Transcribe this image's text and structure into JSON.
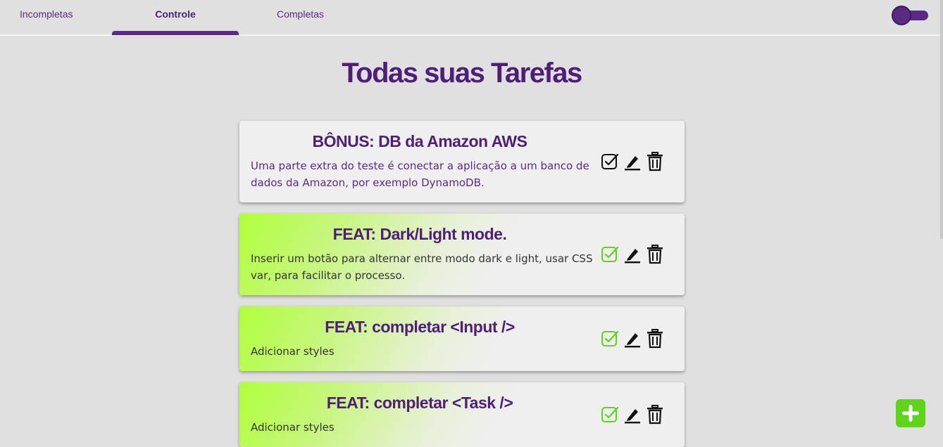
{
  "tabs": [
    {
      "label": "Incompletas"
    },
    {
      "label": "Controle",
      "active": true
    },
    {
      "label": "Completas"
    }
  ],
  "theme_toggle": {
    "state": "dark",
    "color": "#5b2a86"
  },
  "page_title": "Todas suas Tarefas",
  "tasks": [
    {
      "title": "BÔNUS: DB da Amazon AWS",
      "description": "Uma parte extra do teste é conectar a aplicação a um banco de dados da Amazon, por exemplo DynamoDB.",
      "completed": false,
      "icons": [
        "check-square-icon",
        "pencil-icon",
        "trash-icon"
      ]
    },
    {
      "title": "FEAT: Dark/Light mode.",
      "description": "Inserir um botão para alternar entre modo dark e light, usar CSS var, para facilitar o processo.",
      "completed": true,
      "icons": [
        "check-square-icon",
        "pencil-icon",
        "trash-icon"
      ]
    },
    {
      "title": "FEAT: completar <Input />",
      "description": "Adicionar styles",
      "completed": true,
      "icons": [
        "check-square-icon",
        "pencil-icon",
        "trash-icon"
      ]
    },
    {
      "title": "FEAT: completar <Task />",
      "description": "Adicionar styles",
      "completed": true,
      "icons": [
        "check-square-icon",
        "pencil-icon",
        "trash-icon"
      ]
    }
  ],
  "fab": {
    "icon": "plus-icon",
    "color": "#5fd31a"
  },
  "colors": {
    "brand": "#5b2a86",
    "completed_accent": "#5fd31a",
    "background": "#e0e0e0",
    "card": "#efefef"
  }
}
